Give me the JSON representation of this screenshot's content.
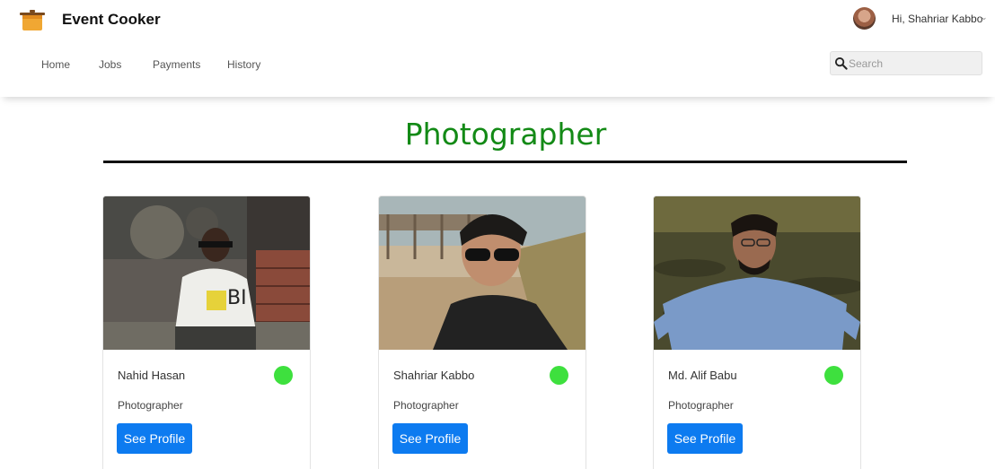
{
  "app": {
    "brand": "Event Cooker",
    "logo_icon": "cooking-pot-icon"
  },
  "nav": {
    "items": [
      "Home",
      "Jobs",
      "Payments",
      "History"
    ]
  },
  "user": {
    "greeting": "Hi, Shahriar Kabbo",
    "menu_icon": "chevron-down-icon"
  },
  "search": {
    "placeholder": "Search",
    "icon": "search-icon"
  },
  "page": {
    "title": "Photographer",
    "title_color": "#138a16"
  },
  "cards": [
    {
      "name": "Nahid Hasan",
      "role": "Photographer",
      "button": "See Profile",
      "status": "online",
      "status_color": "#3ee03e"
    },
    {
      "name": "Shahriar Kabbo",
      "role": "Photographer",
      "button": "See Profile",
      "status": "online",
      "status_color": "#3ee03e"
    },
    {
      "name": "Md. Alif Babu",
      "role": "Photographer",
      "button": "See Profile",
      "status": "online",
      "status_color": "#3ee03e"
    }
  ],
  "colors": {
    "button": "#0d7bf0",
    "status_online": "#3ee03e"
  }
}
